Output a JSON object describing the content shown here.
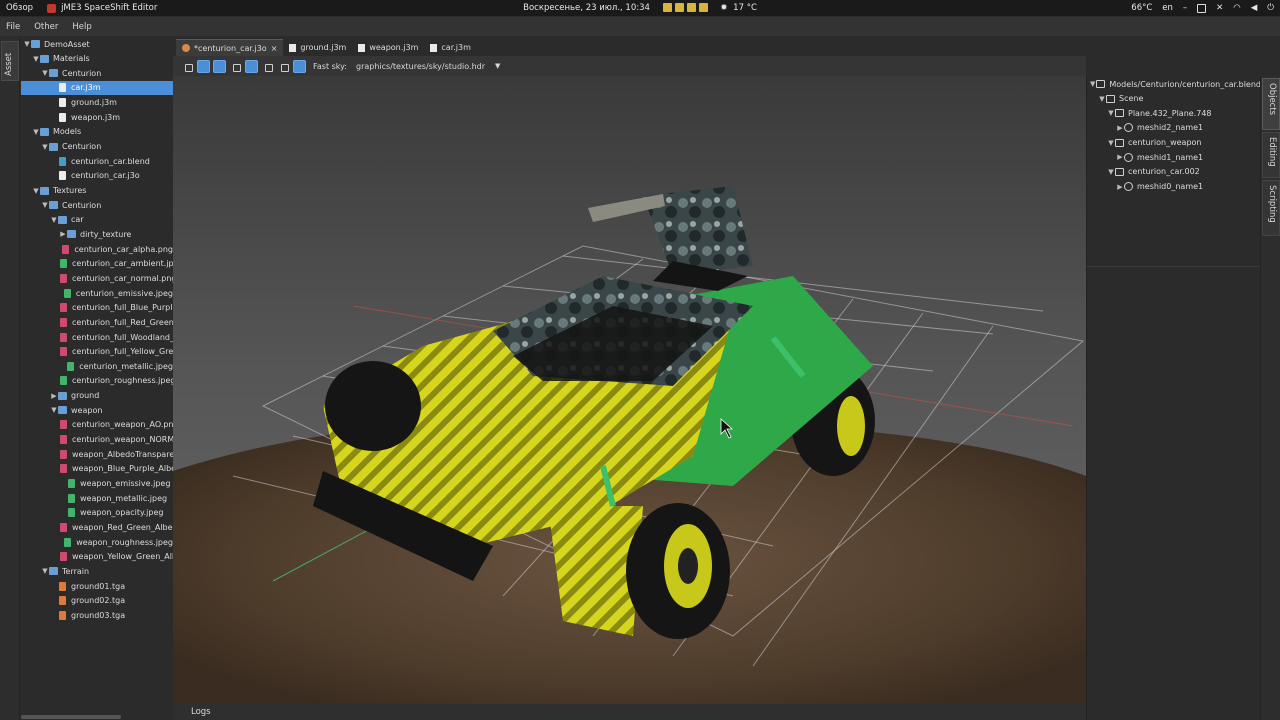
{
  "system": {
    "overview": "Обзор",
    "app_title": "jME3 SpaceShift Editor",
    "datetime": "Воскресенье, 23 июл., 10:34",
    "weather": "17 °C",
    "cpu_temp": "66°C",
    "lang": "en"
  },
  "menu": {
    "items": [
      "File",
      "Other",
      "Help"
    ]
  },
  "left_tab": "Asset",
  "asset_tree": [
    {
      "label": "DemoAsset",
      "depth": 0,
      "kind": "folder",
      "open": true
    },
    {
      "label": "Materials",
      "depth": 1,
      "kind": "folder",
      "open": true
    },
    {
      "label": "Centurion",
      "depth": 2,
      "kind": "folder",
      "open": true
    },
    {
      "label": "car.j3m",
      "depth": 3,
      "kind": "j3m",
      "selected": true
    },
    {
      "label": "ground.j3m",
      "depth": 3,
      "kind": "j3m"
    },
    {
      "label": "weapon.j3m",
      "depth": 3,
      "kind": "j3m"
    },
    {
      "label": "Models",
      "depth": 1,
      "kind": "folder",
      "open": true
    },
    {
      "label": "Centurion",
      "depth": 2,
      "kind": "folder",
      "open": true
    },
    {
      "label": "centurion_car.blend",
      "depth": 3,
      "kind": "blend"
    },
    {
      "label": "centurion_car.j3o",
      "depth": 3,
      "kind": "j3m"
    },
    {
      "label": "Textures",
      "depth": 1,
      "kind": "folder",
      "open": true
    },
    {
      "label": "Centurion",
      "depth": 2,
      "kind": "folder",
      "open": true
    },
    {
      "label": "car",
      "depth": 3,
      "kind": "folder",
      "open": true
    },
    {
      "label": "dirty_texture",
      "depth": 4,
      "kind": "folder",
      "open": false
    },
    {
      "label": "centurion_car_alpha.png",
      "depth": 4,
      "kind": "png"
    },
    {
      "label": "centurion_car_ambient.jpg",
      "depth": 4,
      "kind": "jpg"
    },
    {
      "label": "centurion_car_normal.png",
      "depth": 4,
      "kind": "png"
    },
    {
      "label": "centurion_emissive.jpeg",
      "depth": 4,
      "kind": "jpg"
    },
    {
      "label": "centurion_full_Blue_Purple_A",
      "depth": 4,
      "kind": "png"
    },
    {
      "label": "centurion_full_Red_Green_Al",
      "depth": 4,
      "kind": "png"
    },
    {
      "label": "centurion_full_Woodland_All",
      "depth": 4,
      "kind": "png"
    },
    {
      "label": "centurion_full_Yellow_Green",
      "depth": 4,
      "kind": "png"
    },
    {
      "label": "centurion_metallic.jpeg",
      "depth": 4,
      "kind": "jpg"
    },
    {
      "label": "centurion_roughness.jpeg",
      "depth": 4,
      "kind": "jpg"
    },
    {
      "label": "ground",
      "depth": 3,
      "kind": "folder",
      "open": false
    },
    {
      "label": "weapon",
      "depth": 3,
      "kind": "folder",
      "open": true
    },
    {
      "label": "centurion_weapon_AO.png",
      "depth": 4,
      "kind": "png"
    },
    {
      "label": "centurion_weapon_NORMAL",
      "depth": 4,
      "kind": "png"
    },
    {
      "label": "weapon_AlbedoTransparency",
      "depth": 4,
      "kind": "png"
    },
    {
      "label": "weapon_Blue_Purple_Albedo",
      "depth": 4,
      "kind": "png"
    },
    {
      "label": "weapon_emissive.jpeg",
      "depth": 4,
      "kind": "jpg"
    },
    {
      "label": "weapon_metallic.jpeg",
      "depth": 4,
      "kind": "jpg"
    },
    {
      "label": "weapon_opacity.jpeg",
      "depth": 4,
      "kind": "jpg"
    },
    {
      "label": "weapon_Red_Green_AlbedoT",
      "depth": 4,
      "kind": "png"
    },
    {
      "label": "weapon_roughness.jpeg",
      "depth": 4,
      "kind": "jpg"
    },
    {
      "label": "weapon_Yellow_Green_Albed",
      "depth": 4,
      "kind": "png"
    },
    {
      "label": "Terrain",
      "depth": 2,
      "kind": "folder",
      "open": true
    },
    {
      "label": "ground01.tga",
      "depth": 3,
      "kind": "tga"
    },
    {
      "label": "ground02.tga",
      "depth": 3,
      "kind": "tga"
    },
    {
      "label": "ground03.tga",
      "depth": 3,
      "kind": "tga"
    }
  ],
  "editor_tabs": [
    {
      "label": "*centurion_car.j3o",
      "icon": "car-model-icon",
      "active": true,
      "close": "×"
    },
    {
      "label": "ground.j3m",
      "icon": "material-icon",
      "active": false
    },
    {
      "label": "weapon.j3m",
      "icon": "material-icon",
      "active": false
    },
    {
      "label": "car.j3m",
      "icon": "material-icon",
      "active": false
    }
  ],
  "toolbar": {
    "fast_sky_label": "Fast sky:",
    "sky_path": "graphics/textures/sky/studio.hdr",
    "dropdown_caret": "▼"
  },
  "scene_tree": [
    {
      "label": "Models/Centurion/centurion_car.blend",
      "depth": 0,
      "kind": "node",
      "open": true
    },
    {
      "label": "Scene",
      "depth": 1,
      "kind": "node",
      "open": true
    },
    {
      "label": "Plane.432_Plane.748",
      "depth": 2,
      "kind": "node",
      "open": true
    },
    {
      "label": "meshid2_name1",
      "depth": 3,
      "kind": "mesh",
      "open": false
    },
    {
      "label": "centurion_weapon",
      "depth": 2,
      "kind": "node",
      "open": true
    },
    {
      "label": "meshid1_name1",
      "depth": 3,
      "kind": "mesh",
      "open": false
    },
    {
      "label": "centurion_car.002",
      "depth": 2,
      "kind": "node",
      "open": true
    },
    {
      "label": "meshid0_name1",
      "depth": 3,
      "kind": "mesh",
      "open": false
    }
  ],
  "right_tabs": [
    "Objects",
    "Editing",
    "Scripting"
  ],
  "bottom": {
    "logs_label": "Logs"
  },
  "colors": {
    "selection": "#4b8fd8",
    "car_yellow": "#d6d61e",
    "car_green": "#2fa84a",
    "ground_brown": "#5a4632"
  }
}
